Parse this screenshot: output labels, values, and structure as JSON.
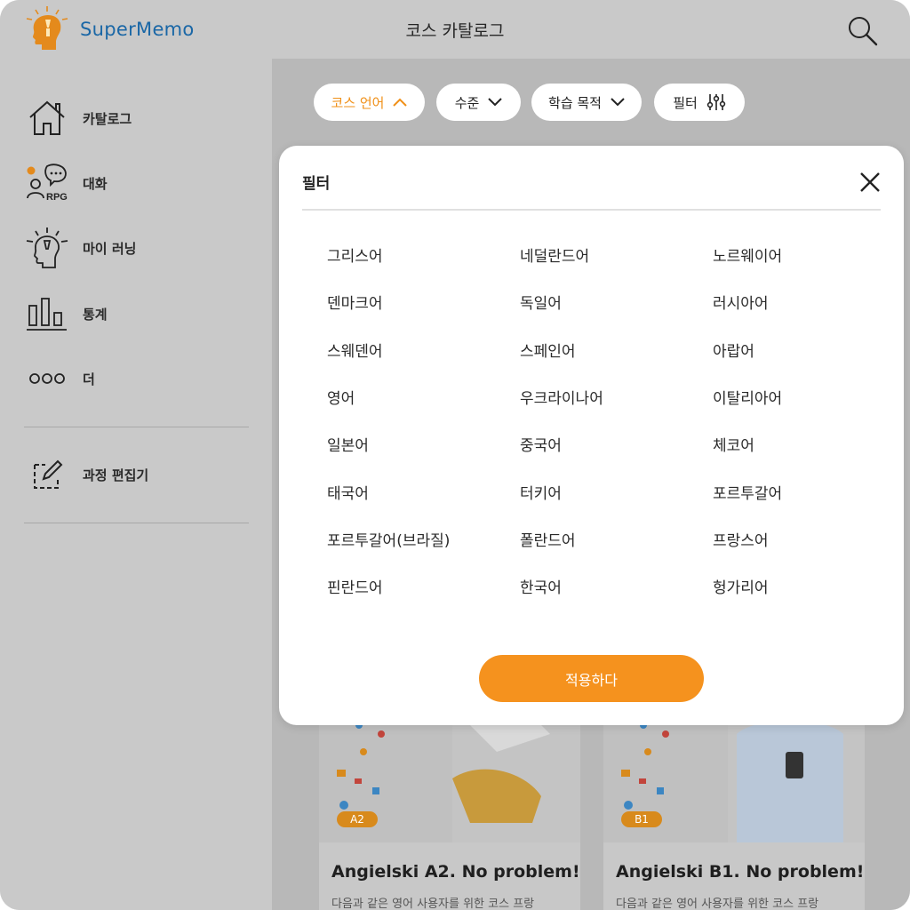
{
  "app": {
    "brand": "SuperMemo",
    "title": "코스 카탈로그"
  },
  "sidebar": {
    "items": [
      {
        "label": "카탈로그",
        "icon": "home-icon"
      },
      {
        "label": "대화",
        "icon": "rpg-chat-icon",
        "icon_text": "RPG"
      },
      {
        "label": "마이 러닝",
        "icon": "lightbulb-head-icon"
      },
      {
        "label": "통계",
        "icon": "bar-chart-icon"
      },
      {
        "label": "더",
        "icon": "more-dots-icon"
      },
      {
        "label": "과정 편집기",
        "icon": "edit-icon"
      }
    ]
  },
  "filters": {
    "chips": [
      {
        "label": "코스 언어",
        "icon": "chevron-up-icon",
        "active": true
      },
      {
        "label": "수준",
        "icon": "chevron-down-icon"
      },
      {
        "label": "학습 목적",
        "icon": "chevron-down-icon"
      },
      {
        "label": "필터",
        "icon": "sliders-icon"
      }
    ]
  },
  "modal": {
    "title": "필터",
    "languages": [
      [
        "그리스어",
        "네덜란드어",
        "노르웨이어"
      ],
      [
        "덴마크어",
        "독일어",
        "러시아어"
      ],
      [
        "스웨덴어",
        "스페인어",
        "아랍어"
      ],
      [
        "영어",
        "우크라이나어",
        "이탈리아어"
      ],
      [
        "일본어",
        "중국어",
        "체코어"
      ],
      [
        "태국어",
        "터키어",
        "포르투갈어"
      ],
      [
        "포르투갈어(브라질)",
        "폴란드어",
        "프랑스어"
      ],
      [
        "핀란드어",
        "한국어",
        "헝가리어"
      ]
    ],
    "apply_label": "적용하다"
  },
  "cards": [
    {
      "badge": "A2",
      "title": "Angielski A2. No problem!",
      "desc": "다음과 같은 영어 사용자를 위한 코스 프랑"
    },
    {
      "badge": "B1",
      "title": "Angielski B1. No problem!",
      "desc": "다음과 같은 영어 사용자를 위한 코스 프랑"
    }
  ],
  "colors": {
    "accent": "#f5921e",
    "brand": "#1a67a6",
    "sidebar_bg": "#c9c9c9"
  }
}
